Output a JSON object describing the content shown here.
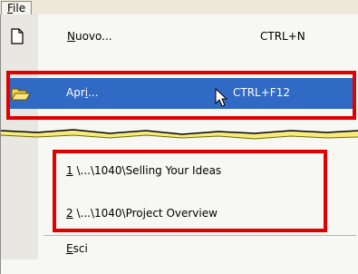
{
  "menubar": {
    "file": "File",
    "file_mnemonic": "F",
    "file_rest": "ile"
  },
  "items": {
    "nuovo": {
      "pre": "",
      "mn": "N",
      "post": "uovo...",
      "shortcut": "CTRL+N"
    },
    "apri": {
      "pre": "Apr",
      "mn": "i",
      "post": "...",
      "shortcut": "CTRL+F12"
    },
    "recent1": {
      "mn": "1",
      "post": " \\...\\1040\\Selling Your Ideas"
    },
    "recent2": {
      "mn": "2",
      "post": " \\...\\1040\\Project Overview"
    },
    "esci": {
      "mn": "E",
      "post": "sci"
    }
  },
  "colors": {
    "highlight": "#316ac5",
    "callout": "#e00000"
  },
  "icons": [
    "new-document-icon",
    "open-folder-icon",
    "mouse-cursor-icon"
  ]
}
